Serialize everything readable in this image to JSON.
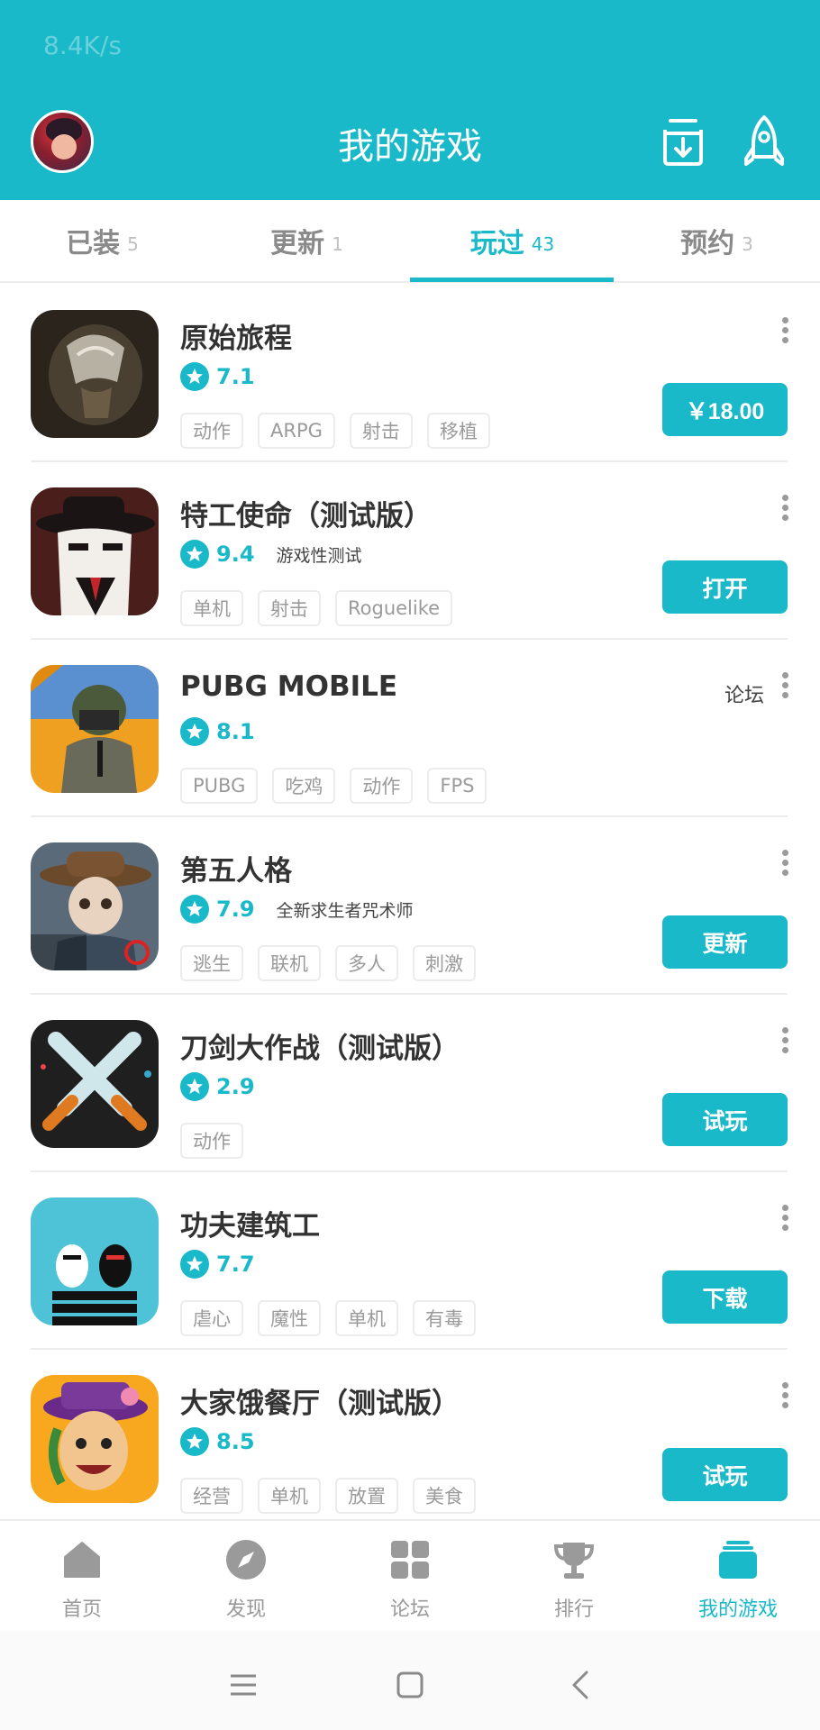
{
  "status": {
    "speed": "8.4K/s"
  },
  "header": {
    "title": "我的游戏",
    "download_icon": "download-tray-icon",
    "rocket_icon": "rocket-icon",
    "accent": "#19b9c9"
  },
  "tabs": [
    {
      "label": "已装",
      "count": "5",
      "active": false
    },
    {
      "label": "更新",
      "count": "1",
      "active": false
    },
    {
      "label": "玩过",
      "count": "43",
      "active": true
    },
    {
      "label": "预约",
      "count": "3",
      "active": false
    }
  ],
  "games": [
    {
      "name": "原始旅程",
      "rating": "7.1",
      "note": "",
      "tags": [
        "动作",
        "ARPG",
        "射击",
        "移植"
      ],
      "action": "￥18.00",
      "forum": ""
    },
    {
      "name": "特工使命（测试版）",
      "rating": "9.4",
      "note": "游戏性测试",
      "tags": [
        "单机",
        "射击",
        "Roguelike"
      ],
      "action": "打开",
      "forum": ""
    },
    {
      "name": "PUBG MOBILE",
      "rating": "8.1",
      "note": "",
      "tags": [
        "PUBG",
        "吃鸡",
        "动作",
        "FPS"
      ],
      "action": "",
      "forum": "论坛"
    },
    {
      "name": "第五人格",
      "rating": "7.9",
      "note": "全新求生者咒术师",
      "tags": [
        "逃生",
        "联机",
        "多人",
        "刺激"
      ],
      "action": "更新",
      "forum": ""
    },
    {
      "name": "刀剑大作战（测试版）",
      "rating": "2.9",
      "note": "",
      "tags": [
        "动作"
      ],
      "action": "试玩",
      "forum": ""
    },
    {
      "name": "功夫建筑工",
      "rating": "7.7",
      "note": "",
      "tags": [
        "虐心",
        "魔性",
        "单机",
        "有毒"
      ],
      "action": "下载",
      "forum": ""
    },
    {
      "name": "大家饿餐厅（测试版）",
      "rating": "8.5",
      "note": "",
      "tags": [
        "经营",
        "单机",
        "放置",
        "美食"
      ],
      "action": "试玩",
      "forum": ""
    }
  ],
  "nav": [
    {
      "label": "首页",
      "icon": "home-icon",
      "active": false
    },
    {
      "label": "发现",
      "icon": "compass-icon",
      "active": false
    },
    {
      "label": "论坛",
      "icon": "grid-icon",
      "active": false
    },
    {
      "label": "排行",
      "icon": "trophy-icon",
      "active": false
    },
    {
      "label": "我的游戏",
      "icon": "stack-icon",
      "active": true
    }
  ],
  "system_nav": [
    "menu-icon",
    "home-square-icon",
    "back-icon"
  ]
}
